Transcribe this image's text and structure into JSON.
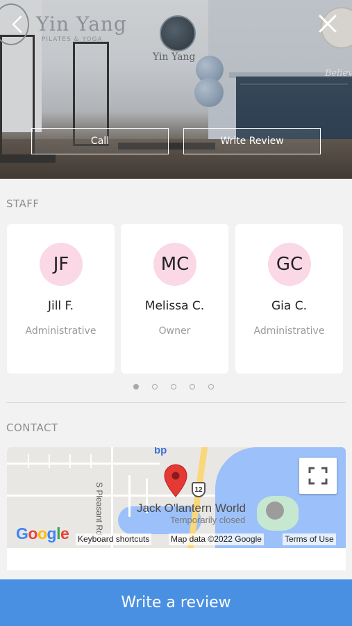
{
  "hero": {
    "logo_text": "Yin Yang",
    "logo_subtext": "PILATES & YOGA",
    "sign_text": "Yin Yang",
    "wall_text": "Believe",
    "call_label": "Call",
    "write_review_label": "Write Review"
  },
  "staff": {
    "section_title": "STAFF",
    "members": [
      {
        "initials": "JF",
        "name": "Jill F.",
        "role": "Administrative"
      },
      {
        "initials": "MC",
        "name": "Melissa C.",
        "role": "Owner"
      },
      {
        "initials": "GC",
        "name": "Gia C.",
        "role": "Administrative"
      }
    ],
    "pagination_count": 5,
    "pagination_active": 0
  },
  "contact": {
    "section_title": "CONTACT",
    "map": {
      "street_label": "S Pleasant Rd",
      "poi_name": "Jack O'lantern World",
      "poi_status": "Temporarily closed",
      "route_shield": "12",
      "bp_label": "bp",
      "google_logo": "Google",
      "keyboard_shortcuts": "Keyboard shortcuts",
      "map_data": "Map data ©2022 Google",
      "terms": "Terms of Use"
    }
  },
  "bottom_bar": {
    "label": "Write a review"
  },
  "colors": {
    "accent": "#4a90e2",
    "avatar_bg": "#fbd8e5",
    "pin": "#e53935"
  }
}
